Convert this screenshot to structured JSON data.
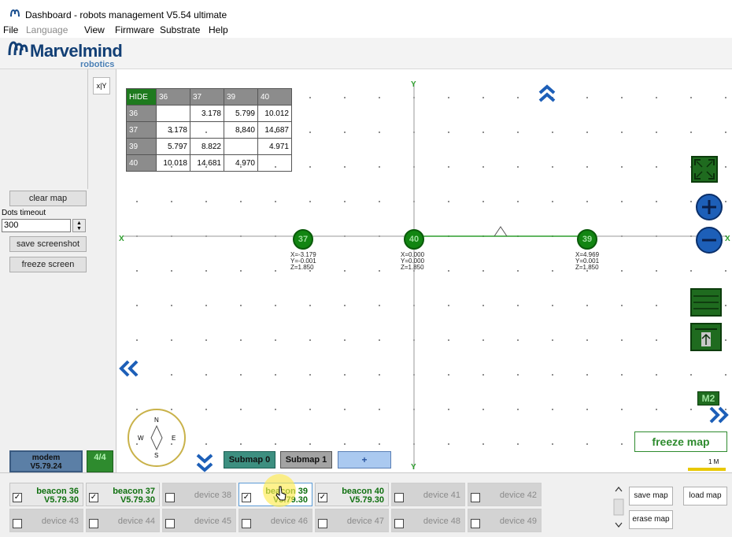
{
  "window": {
    "title": "Dashboard - robots management  V5.54  ultimate"
  },
  "menu": [
    {
      "label": "File",
      "enabled": true
    },
    {
      "label": "Language",
      "enabled": false
    },
    {
      "label": "View",
      "enabled": true
    },
    {
      "label": "Firmware",
      "enabled": true
    },
    {
      "label": "Substrate",
      "enabled": true
    },
    {
      "label": "Help",
      "enabled": true
    }
  ],
  "logo": {
    "name": "Marvelmind",
    "sub": "robotics"
  },
  "left_panel": {
    "axis_button": "x|Y",
    "clear_map": "clear map",
    "dots_timeout_label": "Dots timeout",
    "dots_timeout_value": "300",
    "save_screenshot": "save screenshot",
    "freeze_screen": "freeze screen"
  },
  "modem": {
    "label": "modem",
    "version": "V5.79.24",
    "count": "4/4"
  },
  "distance_table": {
    "corner": "HIDE",
    "headers": [
      "36",
      "37",
      "39",
      "40"
    ],
    "rows": [
      {
        "id": "36",
        "cells": [
          "",
          "3.178",
          "5.799",
          "10.012"
        ]
      },
      {
        "id": "37",
        "cells": [
          "3.178",
          "",
          "8.840",
          "14.687"
        ]
      },
      {
        "id": "39",
        "cells": [
          "5.797",
          "8.822",
          "",
          "4.971"
        ]
      },
      {
        "id": "40",
        "cells": [
          "10.018",
          "14.681",
          "4.970",
          ""
        ]
      }
    ]
  },
  "map": {
    "axis_x_label": "X",
    "axis_y_label": "Y",
    "beacons": [
      {
        "id": "37",
        "x": "X=-3.179",
        "y": "Y=-0.001",
        "z": "Z=1.850"
      },
      {
        "id": "40",
        "x": "X=0.000",
        "y": "Y=0.000",
        "z": "Z=1.850"
      },
      {
        "id": "39",
        "x": "X=4.969",
        "y": "Y=0.001",
        "z": "Z=1.850"
      }
    ],
    "m2_label": "M2",
    "freeze_map": "freeze map",
    "scale_label": "1 M",
    "submaps": [
      "Submap 0",
      "Submap 1",
      "+"
    ],
    "compass": {
      "n": "N",
      "s": "S",
      "e": "E",
      "w": "W"
    }
  },
  "devices": [
    {
      "label": "beacon 36",
      "version": "V5.79.30",
      "active": true,
      "checked": true
    },
    {
      "label": "beacon 37",
      "version": "V5.79.30",
      "active": true,
      "checked": true
    },
    {
      "label": "device 38",
      "version": "",
      "active": false,
      "checked": false
    },
    {
      "label": "beacon 39",
      "version": "V5.79.30",
      "active": true,
      "checked": true
    },
    {
      "label": "beacon 40",
      "version": "V5.79.30",
      "active": true,
      "checked": true
    },
    {
      "label": "device 41",
      "version": "",
      "active": false,
      "checked": false
    },
    {
      "label": "device 42",
      "version": "",
      "active": false,
      "checked": false
    },
    {
      "label": "device 43",
      "version": "",
      "active": false,
      "checked": false
    },
    {
      "label": "device 44",
      "version": "",
      "active": false,
      "checked": false
    },
    {
      "label": "device 45",
      "version": "",
      "active": false,
      "checked": false
    },
    {
      "label": "device 46",
      "version": "",
      "active": false,
      "checked": false
    },
    {
      "label": "device 47",
      "version": "",
      "active": false,
      "checked": false
    },
    {
      "label": "device 48",
      "version": "",
      "active": false,
      "checked": false
    },
    {
      "label": "device 49",
      "version": "",
      "active": false,
      "checked": false
    }
  ],
  "bottom_buttons": {
    "save_map": "save map",
    "load_map": "load map",
    "erase_map": "erase map"
  },
  "colors": {
    "beacon_green": "#128512",
    "axis_green": "#2e9e2e",
    "nav_blue": "#1d5fb8",
    "logo_blue": "#123f75"
  }
}
